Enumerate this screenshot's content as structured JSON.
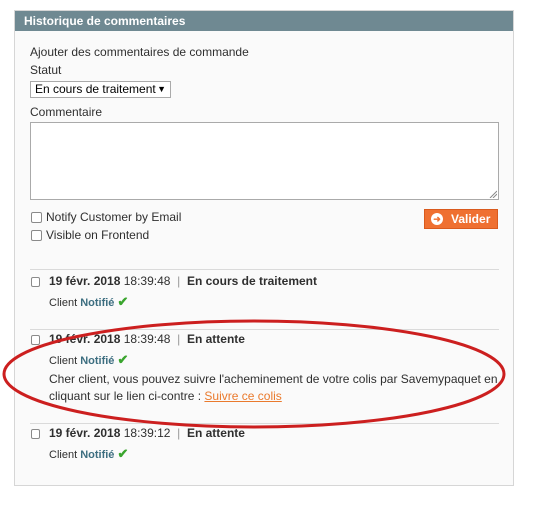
{
  "panel": {
    "title": "Historique de commentaires"
  },
  "form": {
    "heading": "Ajouter des commentaires de commande",
    "status_label": "Statut",
    "status_value": "En cours de traitement",
    "comment_label": "Commentaire",
    "comment_value": "",
    "notify_label": "Notify Customer by Email",
    "visible_label": "Visible on Frontend",
    "submit_label": "Valider"
  },
  "history": [
    {
      "date": "19 févr. 2018",
      "time": "18:39:48",
      "status": "En attente",
      "client": "Client",
      "notified": "Notifié",
      "message": "Cher client, vous pouvez suivre l'acheminement de votre colis par Savemypaquet en cliquant sur le lien ci-contre :",
      "link": "Suivre ce colis"
    },
    {
      "date": "19 févr. 2018",
      "time": "18:39:48",
      "status": "En cours de traitement",
      "client": "Client",
      "notified": "Notifié"
    },
    {
      "date": "19 févr. 2018",
      "time": "18:39:12",
      "status": "En attente",
      "client": "Client",
      "notified": "Notifié"
    }
  ],
  "colors": {
    "header": "#6f8992",
    "button": "#ef7031",
    "annotation": "#cc1f1f",
    "check": "#3aa52e"
  }
}
